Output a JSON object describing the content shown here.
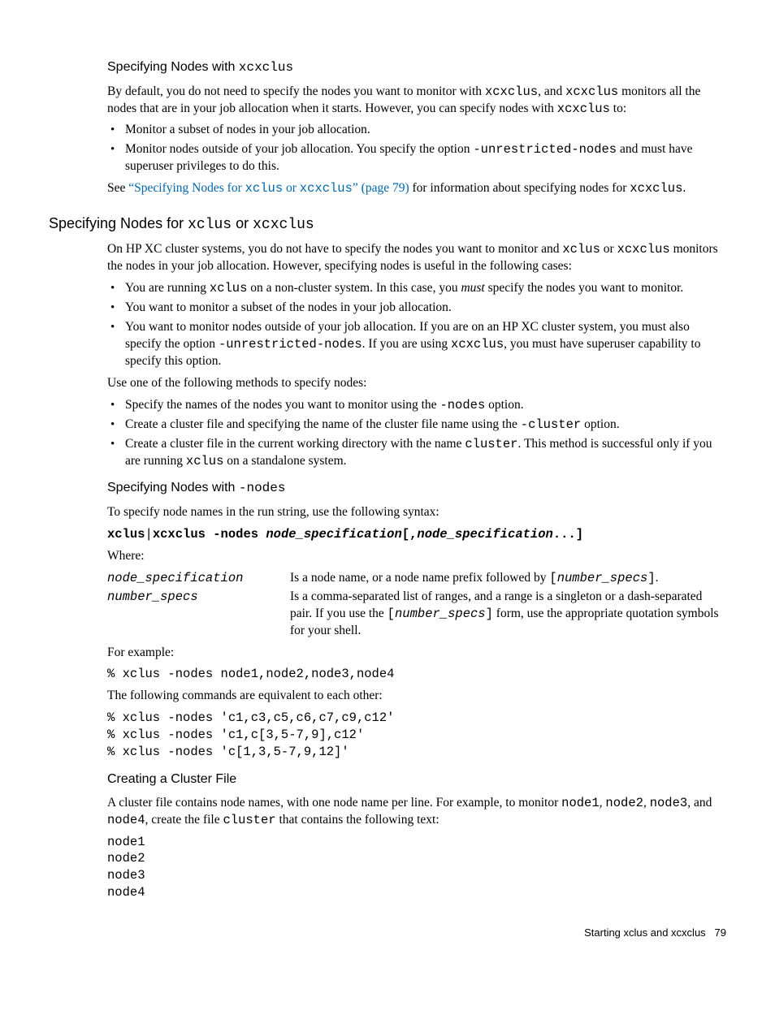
{
  "sec1": {
    "heading_a": "Specifying Nodes with ",
    "heading_b": "xcxclus",
    "p1_a": "By default, you do not need to specify the nodes you want to monitor with ",
    "p1_b": "xcxclus",
    "p1_c": ", and ",
    "p1_d": "xcxclus",
    "p1_e": " monitors all the nodes that are in your job allocation when it starts. However, you can specify nodes with ",
    "p1_f": "xcxclus",
    "p1_g": " to:",
    "li1": "Monitor a subset of nodes in your job allocation.",
    "li2_a": "Monitor nodes outside of your job allocation. You specify the option ",
    "li2_b": "-unrestricted-nodes",
    "li2_c": " and must have superuser privileges to do this.",
    "p2_a": "See ",
    "p2_link_a": "“Specifying Nodes for ",
    "p2_link_b": "xclus",
    "p2_link_c": " or ",
    "p2_link_d": "xcxclus",
    "p2_link_e": "” (page 79)",
    "p2_b": " for information about specifying nodes for ",
    "p2_c": "xcxclus",
    "p2_d": "."
  },
  "sec2": {
    "heading_a": "Specifying Nodes for ",
    "heading_b": "xclus",
    "heading_c": " or ",
    "heading_d": "xcxclus",
    "p1_a": "On HP XC cluster systems, you do not have to specify the nodes you want to monitor and ",
    "p1_b": "xclus",
    "p1_c": " or ",
    "p1_d": "xcxclus",
    "p1_e": " monitors the nodes in your job allocation. However, specifying nodes is useful in the following cases:",
    "li1_a": "You are running ",
    "li1_b": "xclus",
    "li1_c": " on a non-cluster system. In this case, you ",
    "li1_d": "must",
    "li1_e": " specify the nodes you want to monitor.",
    "li2": "You want to monitor a subset of the nodes in your job allocation.",
    "li3_a": "You want to monitor nodes outside of your job allocation. If you are on an HP XC cluster system, you must also specify the option ",
    "li3_b": "-unrestricted-nodes",
    "li3_c": ". If you are using ",
    "li3_d": "xcxclus",
    "li3_e": ", you must have superuser capability to specify this option.",
    "p2": "Use one of the following methods to specify nodes:",
    "mli1_a": "Specify the names of the nodes you want to monitor using the ",
    "mli1_b": "-nodes",
    "mli1_c": " option.",
    "mli2_a": "Create a cluster file and specifying the name of the cluster file name using the ",
    "mli2_b": "-cluster",
    "mli2_c": " option.",
    "mli3_a": "Create a cluster file in the current working directory with the name ",
    "mli3_b": "cluster",
    "mli3_c": ". This method is successful only if you are running ",
    "mli3_d": "xclus",
    "mli3_e": " on a standalone system."
  },
  "sec3": {
    "heading_a": "Specifying Nodes with ",
    "heading_b": "-nodes",
    "p1": "To specify node names in the run string, use the following syntax:",
    "syntax_a": "xclus",
    "syntax_b": "|",
    "syntax_c": "xcxclus -nodes ",
    "syntax_d": "node_specification",
    "syntax_e": "[,",
    "syntax_f": "node_specification",
    "syntax_g": "...]",
    "where": "Where:",
    "t1": "node_specification",
    "d1_a": "Is a node name, or a node name prefix followed by ",
    "d1_b": "[",
    "d1_c": "number_specs",
    "d1_d": "]",
    "d1_e": ".",
    "t2": "number_specs",
    "d2_a": "Is a comma-separated list of ranges, and a range is a singleton or a dash-separated pair. If you use the ",
    "d2_b": "[",
    "d2_c": "number_specs",
    "d2_d": "]",
    "d2_e": " form, use the appropriate quotation symbols for your shell.",
    "p2": "For example:",
    "ex1": "% xclus -nodes node1,node2,node3,node4",
    "p3": "The following commands are equivalent to each other:",
    "ex2": "% xclus -nodes 'c1,c3,c5,c6,c7,c9,c12'\n% xclus -nodes 'c1,c[3,5-7,9],c12'\n% xclus -nodes 'c[1,3,5-7,9,12]'"
  },
  "sec4": {
    "heading": "Creating a Cluster File",
    "p1_a": "A cluster file contains node names, with one node name per line. For example, to monitor ",
    "p1_b": "node1",
    "p1_c": ", ",
    "p1_d": "node2",
    "p1_e": ", ",
    "p1_f": "node3",
    "p1_g": ", and ",
    "p1_h": "node4",
    "p1_i": ", create the file ",
    "p1_j": "cluster",
    "p1_k": " that contains the following text:",
    "ex": "node1\nnode2\nnode3\nnode4"
  },
  "footer": {
    "text": "Starting xclus and xcxclus",
    "page": "79"
  }
}
